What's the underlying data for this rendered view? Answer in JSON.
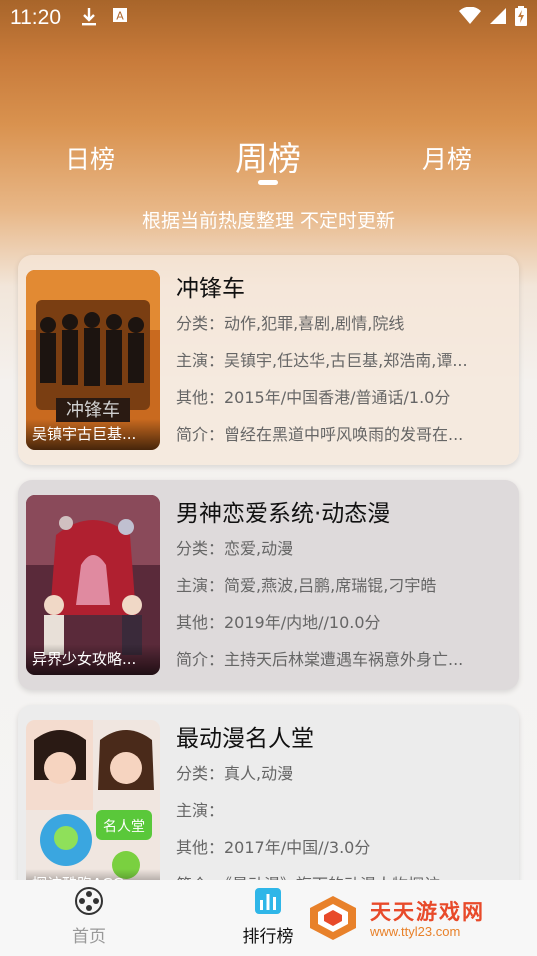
{
  "status_bar": {
    "time": "11:20"
  },
  "tabs": {
    "day": "日榜",
    "week": "周榜",
    "month": "月榜",
    "active": "week"
  },
  "subtitle": "根据当前热度整理 不定时更新",
  "cards": [
    {
      "title": "冲锋车",
      "poster_caption": "吴镇宇古巨基...",
      "category": "分类：动作,犯罪,喜剧,剧情,院线",
      "cast": "主演：吴镇宇,任达华,古巨基,郑浩南,谭...",
      "other": "其他：2015年/中国香港/普通话/1.0分",
      "intro": "简介：曾经在黑道中呼风唤雨的发哥在..."
    },
    {
      "title": "男神恋爱系统·动态漫",
      "poster_caption": "异界少女攻略...",
      "category": "分类：恋爱,动漫",
      "cast": "主演：简爱,燕波,吕鹏,席瑞锟,刁宇皓",
      "other": "其他：2019年/内地//10.0分",
      "intro": "简介：主持天后林棠遭遇车祸意外身亡..."
    },
    {
      "title": "最动漫名人堂",
      "poster_caption": "探访酷跑ACG",
      "category": "分类：真人,动漫",
      "cast": "主演：",
      "other": "其他：2017年/中国//3.0分",
      "intro": "简介：《最动漫》旗下的动漫人物探访..."
    }
  ],
  "bottom_nav": {
    "home": "首页",
    "rank": "排行榜"
  },
  "watermark": {
    "text": "天天游戏网",
    "url": "www.ttyl23.com"
  },
  "colors": {
    "accent": "#e84a2a",
    "header_orange": "#d9924f"
  }
}
